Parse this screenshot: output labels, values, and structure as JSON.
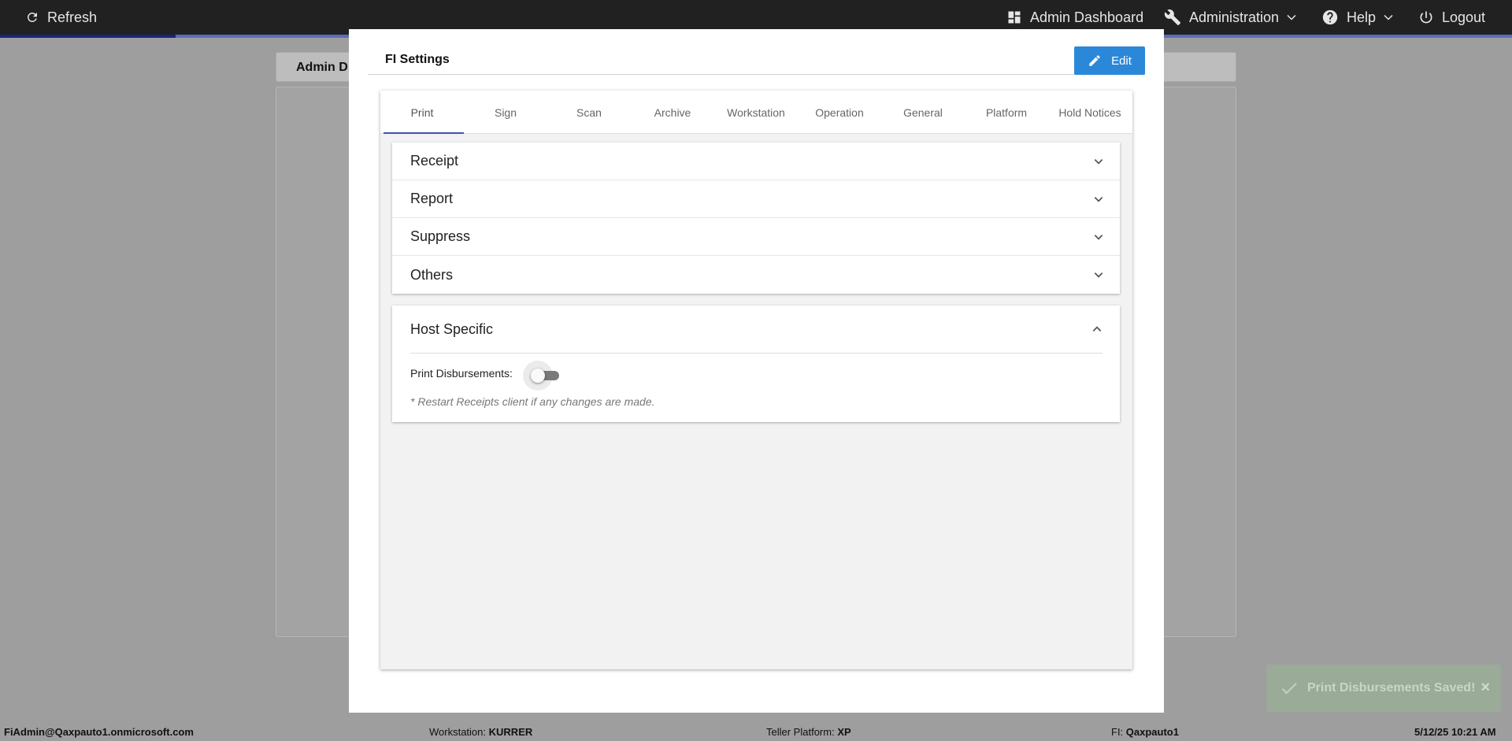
{
  "topbar": {
    "refresh_label": "Refresh",
    "dashboard_label": "Admin Dashboard",
    "administration_label": "Administration",
    "help_label": "Help",
    "logout_label": "Logout"
  },
  "background": {
    "header_title": "Admin D"
  },
  "modal": {
    "title": "FI Settings",
    "edit_label": "Edit",
    "tabs": [
      {
        "label": "Print"
      },
      {
        "label": "Sign"
      },
      {
        "label": "Scan"
      },
      {
        "label": "Archive"
      },
      {
        "label": "Workstation"
      },
      {
        "label": "Operation"
      },
      {
        "label": "General"
      },
      {
        "label": "Platform"
      },
      {
        "label": "Hold Notices"
      }
    ],
    "active_tab": "Print",
    "sections": [
      {
        "label": "Receipt"
      },
      {
        "label": "Report"
      },
      {
        "label": "Suppress"
      },
      {
        "label": "Others"
      }
    ],
    "host": {
      "title": "Host Specific",
      "print_disbursements_label": "Print Disbursements:",
      "print_disbursements_enabled": false,
      "note": "* Restart Receipts client if any changes are made."
    }
  },
  "toast": {
    "message": "Print Disbursements Saved!",
    "close": "×"
  },
  "statusbar": {
    "user": "FiAdmin@Qaxpauto1.onmicrosoft.com",
    "workstation_label": "Workstation:",
    "workstation_value": "KURRER",
    "platform_label": "Teller Platform:",
    "platform_value": "XP",
    "fi_label": "FI:",
    "fi_value": "Qaxpauto1",
    "datetime": "5/12/25 10:21 AM"
  },
  "colors": {
    "accent": "#2b88d8",
    "tab_indicator": "#3f51b5",
    "topbar": "#212121"
  }
}
